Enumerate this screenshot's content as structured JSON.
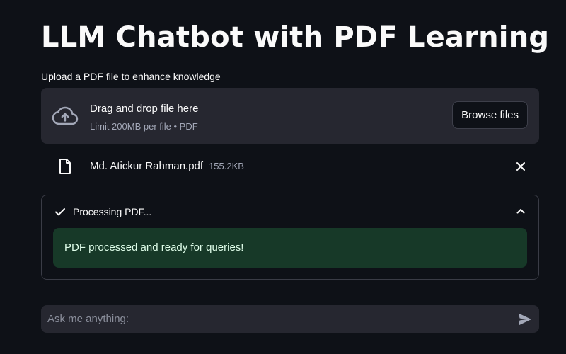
{
  "header": {
    "title": "LLM Chatbot with PDF Learning"
  },
  "uploader": {
    "label": "Upload a PDF file to enhance knowledge",
    "drop_title": "Drag and drop file here",
    "drop_subtitle": "Limit 200MB per file • PDF",
    "browse_label": "Browse files",
    "icon": "cloud-upload-icon"
  },
  "uploaded_file": {
    "name": "Md. Atickur Rahman.pdf",
    "size": "155.2KB",
    "icon": "file-icon",
    "remove_icon": "close-icon"
  },
  "status": {
    "label": "Processing PDF...",
    "state_icon": "check-icon",
    "toggle_icon": "chevron-up-icon",
    "message": "PDF processed and ready for queries!"
  },
  "chat": {
    "placeholder": "Ask me anything:",
    "value": "",
    "send_icon": "send-icon"
  },
  "colors": {
    "background": "#0e1117",
    "surface": "#262730",
    "success_bg": "#173928",
    "success_text": "#dffde9",
    "muted_text": "#a3a8b8"
  }
}
